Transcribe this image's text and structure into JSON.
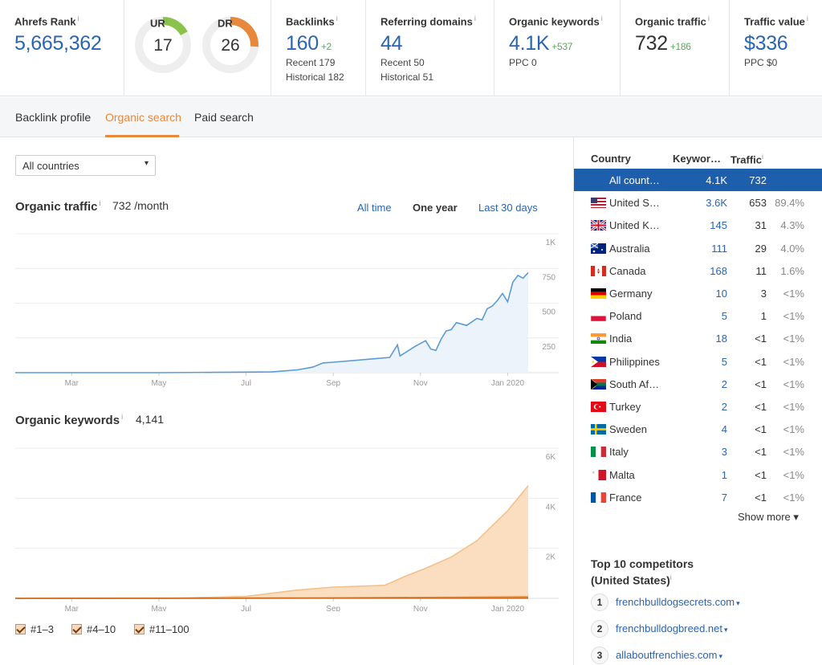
{
  "metrics": {
    "ahrefs_rank": {
      "label": "Ahrefs Rank",
      "value": "5,665,362"
    },
    "ur": {
      "label": "UR",
      "value": "17",
      "fraction": 0.17,
      "color": "#8bc34a"
    },
    "dr": {
      "label": "DR",
      "value": "26",
      "fraction": 0.26,
      "color": "#e8883a"
    },
    "backlinks": {
      "label": "Backlinks",
      "value": "160",
      "delta": "+2",
      "recent": "Recent 179",
      "historical": "Historical 182"
    },
    "referring_domains": {
      "label": "Referring domains",
      "value": "44",
      "recent": "Recent 50",
      "historical": "Historical 51"
    },
    "organic_keywords": {
      "label": "Organic keywords",
      "value": "4.1K",
      "delta": "+537",
      "ppc": "PPC 0"
    },
    "organic_traffic": {
      "label": "Organic traffic",
      "value": "732",
      "delta": "+186"
    },
    "traffic_value": {
      "label": "Traffic value",
      "value": "$336",
      "ppc": "PPC $0"
    },
    "info": "i"
  },
  "tabs": [
    {
      "label": "Backlink profile",
      "active": false
    },
    {
      "label": "Organic search",
      "active": true
    },
    {
      "label": "Paid search",
      "active": false
    }
  ],
  "filter": {
    "selected": "All countries",
    "caret": "▾"
  },
  "traffic_section": {
    "title": "Organic traffic",
    "value": "732 /month",
    "ranges": [
      "All time",
      "One year",
      "Last 30 days"
    ],
    "active_range": "One year"
  },
  "keywords_section": {
    "title": "Organic keywords",
    "value": "4,141",
    "legend": [
      "#1–3",
      "#4–10",
      "#11–100"
    ]
  },
  "chart_data": [
    {
      "type": "area",
      "x_ticks": [
        "Mar",
        "May",
        "Jul",
        "Sep",
        "Nov",
        "Jan 2020"
      ],
      "y_ticks": [
        "1K",
        "750",
        "500",
        "250"
      ],
      "ylim": [
        0,
        1000
      ],
      "grid": true,
      "color": "#5b9bd5",
      "fill": "#eaf2fb",
      "series": [
        {
          "x": [
            0,
            0.28,
            0.5,
            0.55,
            0.58,
            0.6,
            0.62,
            0.7,
            0.73,
            0.745,
            0.75,
            0.78,
            0.8,
            0.81,
            0.82,
            0.83,
            0.84,
            0.85,
            0.86,
            0.88,
            0.9,
            0.91,
            0.92,
            0.93,
            0.94,
            0.95,
            0.96,
            0.97,
            0.98,
            0.99,
            1.0
          ],
          "values": [
            0,
            0,
            5,
            20,
            40,
            70,
            75,
            100,
            110,
            200,
            120,
            190,
            230,
            170,
            160,
            240,
            300,
            310,
            360,
            340,
            390,
            380,
            460,
            480,
            520,
            570,
            510,
            650,
            700,
            680,
            720
          ]
        }
      ]
    },
    {
      "type": "area",
      "x_ticks": [
        "Mar",
        "May",
        "Jul",
        "Sep",
        "Nov",
        "Jan 2020"
      ],
      "y_ticks": [
        "6K",
        "4K",
        "2K"
      ],
      "ylim": [
        0,
        6000
      ],
      "grid": true,
      "series": [
        {
          "name": "#11–100",
          "color": "#f4c08a",
          "fill": "#fbd9b8",
          "x": [
            0,
            0.3,
            0.45,
            0.55,
            0.62,
            0.72,
            0.76,
            0.8,
            0.85,
            0.9,
            0.93,
            0.96,
            1.0
          ],
          "values": [
            0,
            0,
            80,
            330,
            450,
            520,
            880,
            1200,
            1650,
            2300,
            2900,
            3500,
            4500
          ]
        },
        {
          "name": "#4–10",
          "color": "#e8883a",
          "fill": "#e8883a",
          "x": [
            0,
            0.6,
            1.0
          ],
          "values": [
            0,
            20,
            60
          ]
        },
        {
          "name": "#1–3",
          "color": "#c96a1c",
          "fill": "#c96a1c",
          "x": [
            0,
            1.0
          ],
          "values": [
            0,
            5
          ]
        }
      ]
    }
  ],
  "country_table": {
    "headers": {
      "country": "Country",
      "keywords": "Keywor…",
      "traffic": "Traffic"
    },
    "rows": [
      {
        "name": "All count…",
        "kw": "4.1K",
        "tr": "732",
        "pct": "",
        "flag": "none",
        "selected": true
      },
      {
        "name": "United S…",
        "kw": "3.6K",
        "tr": "653",
        "pct": "89.4%",
        "flag": "us"
      },
      {
        "name": "United K…",
        "kw": "145",
        "tr": "31",
        "pct": "4.3%",
        "flag": "uk"
      },
      {
        "name": "Australia",
        "kw": "111",
        "tr": "29",
        "pct": "4.0%",
        "flag": "au"
      },
      {
        "name": "Canada",
        "kw": "168",
        "tr": "11",
        "pct": "1.6%",
        "flag": "ca"
      },
      {
        "name": "Germany",
        "kw": "10",
        "tr": "3",
        "pct": "<1%",
        "flag": "de"
      },
      {
        "name": "Poland",
        "kw": "5",
        "tr": "1",
        "pct": "<1%",
        "flag": "pl"
      },
      {
        "name": "India",
        "kw": "18",
        "tr": "<1",
        "pct": "<1%",
        "flag": "in"
      },
      {
        "name": "Philippines",
        "kw": "5",
        "tr": "<1",
        "pct": "<1%",
        "flag": "ph"
      },
      {
        "name": "South Af…",
        "kw": "2",
        "tr": "<1",
        "pct": "<1%",
        "flag": "za"
      },
      {
        "name": "Turkey",
        "kw": "2",
        "tr": "<1",
        "pct": "<1%",
        "flag": "tr"
      },
      {
        "name": "Sweden",
        "kw": "4",
        "tr": "<1",
        "pct": "<1%",
        "flag": "se"
      },
      {
        "name": "Italy",
        "kw": "3",
        "tr": "<1",
        "pct": "<1%",
        "flag": "it"
      },
      {
        "name": "Malta",
        "kw": "1",
        "tr": "<1",
        "pct": "<1%",
        "flag": "mt"
      },
      {
        "name": "France",
        "kw": "7",
        "tr": "<1",
        "pct": "<1%",
        "flag": "fr"
      }
    ],
    "show_more": "Show more ▾"
  },
  "competitors": {
    "title_line1": "Top 10 competitors",
    "title_line2": "(United States)",
    "items": [
      {
        "num": "1",
        "domain": "frenchbulldogsecrets.com"
      },
      {
        "num": "2",
        "domain": "frenchbulldogbreed.net"
      },
      {
        "num": "3",
        "domain": "allaboutfrenchies.com"
      }
    ],
    "dropdown": "▾"
  }
}
